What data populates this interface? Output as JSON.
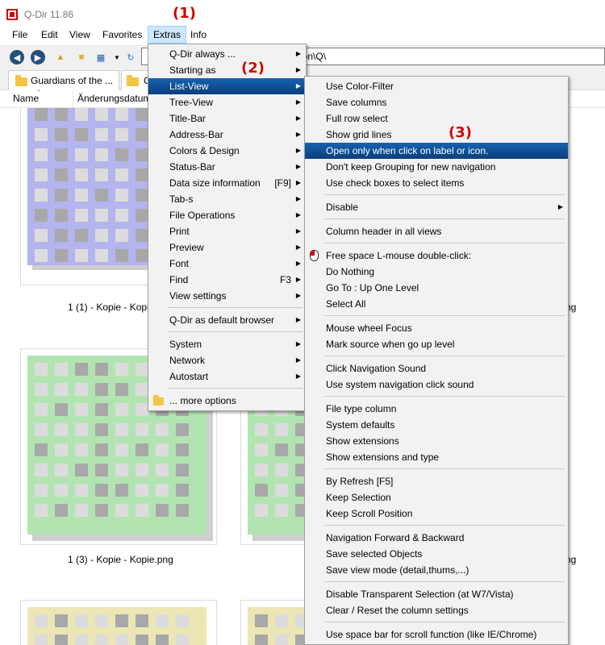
{
  "window": {
    "title": "Q-Dir 11.86"
  },
  "menubar": [
    "File",
    "Edit",
    "View",
    "Favorites",
    "Extras",
    "Info"
  ],
  "address": {
    "value": "g\\icon\\Q\\"
  },
  "tabs": [
    {
      "label": "Guardians of the ..."
    },
    {
      "label": "C"
    }
  ],
  "columns": {
    "name": "Name",
    "date": "Änderungsdatum"
  },
  "files": [
    {
      "caption": "1 (1) - Kopie - Kopi",
      "color": "#b4b4ee"
    },
    {
      "caption": "ng",
      "color": "#b4b4ee"
    },
    {
      "caption": "1 (3) - Kopie - Kopie.png",
      "color": "#b2e4b2"
    },
    {
      "caption": "ng",
      "color": "#b2e4b2"
    },
    {
      "caption": "",
      "color": "#ece6b4"
    },
    {
      "caption": "",
      "color": "#ece6b4"
    }
  ],
  "extras_menu": {
    "items": [
      {
        "label": "Q-Dir always ...",
        "arrow": true
      },
      {
        "label": "Starting as",
        "arrow": true
      },
      {
        "label": "List-View",
        "arrow": true,
        "highlight": true
      },
      {
        "label": "Tree-View",
        "arrow": true
      },
      {
        "label": "Title-Bar",
        "arrow": true
      },
      {
        "label": "Address-Bar",
        "arrow": true
      },
      {
        "label": "Colors & Design",
        "arrow": true
      },
      {
        "label": "Status-Bar",
        "arrow": true
      },
      {
        "label": "Data size information",
        "shortcut": "[F9]",
        "arrow": true
      },
      {
        "label": "Tab-s",
        "arrow": true
      },
      {
        "label": "File Operations",
        "arrow": true
      },
      {
        "label": "Print",
        "arrow": true
      },
      {
        "label": "Preview",
        "arrow": true
      },
      {
        "label": "Font",
        "arrow": true
      },
      {
        "label": "Find",
        "shortcut": "F3",
        "arrow": true
      },
      {
        "label": "View settings",
        "arrow": true
      },
      {
        "separator": true
      },
      {
        "label": "Q-Dir as default browser",
        "arrow": true
      },
      {
        "separator": true
      },
      {
        "label": "System",
        "arrow": true
      },
      {
        "label": "Network",
        "arrow": true
      },
      {
        "label": "Autostart",
        "arrow": true
      },
      {
        "separator": true
      },
      {
        "label": "... more options",
        "icon": "folder-icon"
      }
    ]
  },
  "listview_menu": {
    "items": [
      {
        "label": "Use Color-Filter"
      },
      {
        "label": "Save columns"
      },
      {
        "label": "Full row select"
      },
      {
        "label": "Show grid lines"
      },
      {
        "label": "Open only when click on label or icon.",
        "highlight": true
      },
      {
        "label": "Don't keep Grouping for new navigation"
      },
      {
        "label": "Use check boxes to select items"
      },
      {
        "separator": true
      },
      {
        "label": "Disable",
        "arrow": true
      },
      {
        "separator": true
      },
      {
        "label": "Column header in all views"
      },
      {
        "separator": true
      },
      {
        "label": "Free space L-mouse double-click:",
        "icon": "mouse-icon"
      },
      {
        "label": "Do Nothing"
      },
      {
        "label": "Go To : Up One Level"
      },
      {
        "label": "Select All"
      },
      {
        "separator": true
      },
      {
        "label": "Mouse wheel Focus"
      },
      {
        "label": "Mark source when go up level"
      },
      {
        "separator": true
      },
      {
        "label": "Click Navigation Sound"
      },
      {
        "label": "Use system navigation click sound"
      },
      {
        "separator": true
      },
      {
        "label": "File type column"
      },
      {
        "label": "System defaults"
      },
      {
        "label": "Show extensions"
      },
      {
        "label": "Show extensions and type"
      },
      {
        "separator": true
      },
      {
        "label": "By Refresh [F5]"
      },
      {
        "label": "Keep Selection"
      },
      {
        "label": "Keep Scroll Position"
      },
      {
        "separator": true
      },
      {
        "label": "Navigation Forward & Backward"
      },
      {
        "label": "Save selected Objects"
      },
      {
        "label": "Save view mode (detail,thums,...)"
      },
      {
        "separator": true
      },
      {
        "label": "Disable Transparent Selection (at W7/Vista)"
      },
      {
        "label": "Clear / Reset the column settings"
      },
      {
        "separator": true
      },
      {
        "label": "Use space bar for scroll function (like IE/Chrome)"
      }
    ]
  },
  "annotations": [
    "(1)",
    "(2)",
    "(3)"
  ],
  "colors": {
    "highlight": "#0a4a8f",
    "annotation": "#d00000",
    "menu_bg": "#f2f2f2"
  }
}
